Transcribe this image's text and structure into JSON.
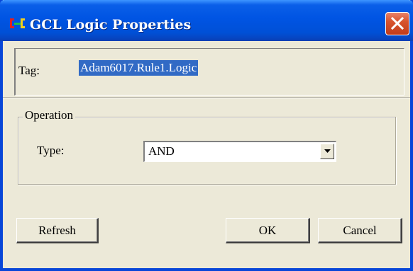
{
  "window": {
    "title": "GCL Logic Properties",
    "app_icon": "gcl-logic-icon",
    "close_icon": "close-icon"
  },
  "tag": {
    "label": "Tag:",
    "value": "Adam6017.Rule1.Logic"
  },
  "operation": {
    "group_label": "Operation",
    "type_label": "Type:",
    "type_value": "AND",
    "dropdown_icon": "chevron-down-icon"
  },
  "buttons": {
    "refresh": "Refresh",
    "ok": "OK",
    "cancel": "Cancel"
  },
  "colors": {
    "titlebar": "#0054e3",
    "dialog_face": "#ece9d8",
    "selection": "#316ac5",
    "close_button": "#d8542e"
  }
}
